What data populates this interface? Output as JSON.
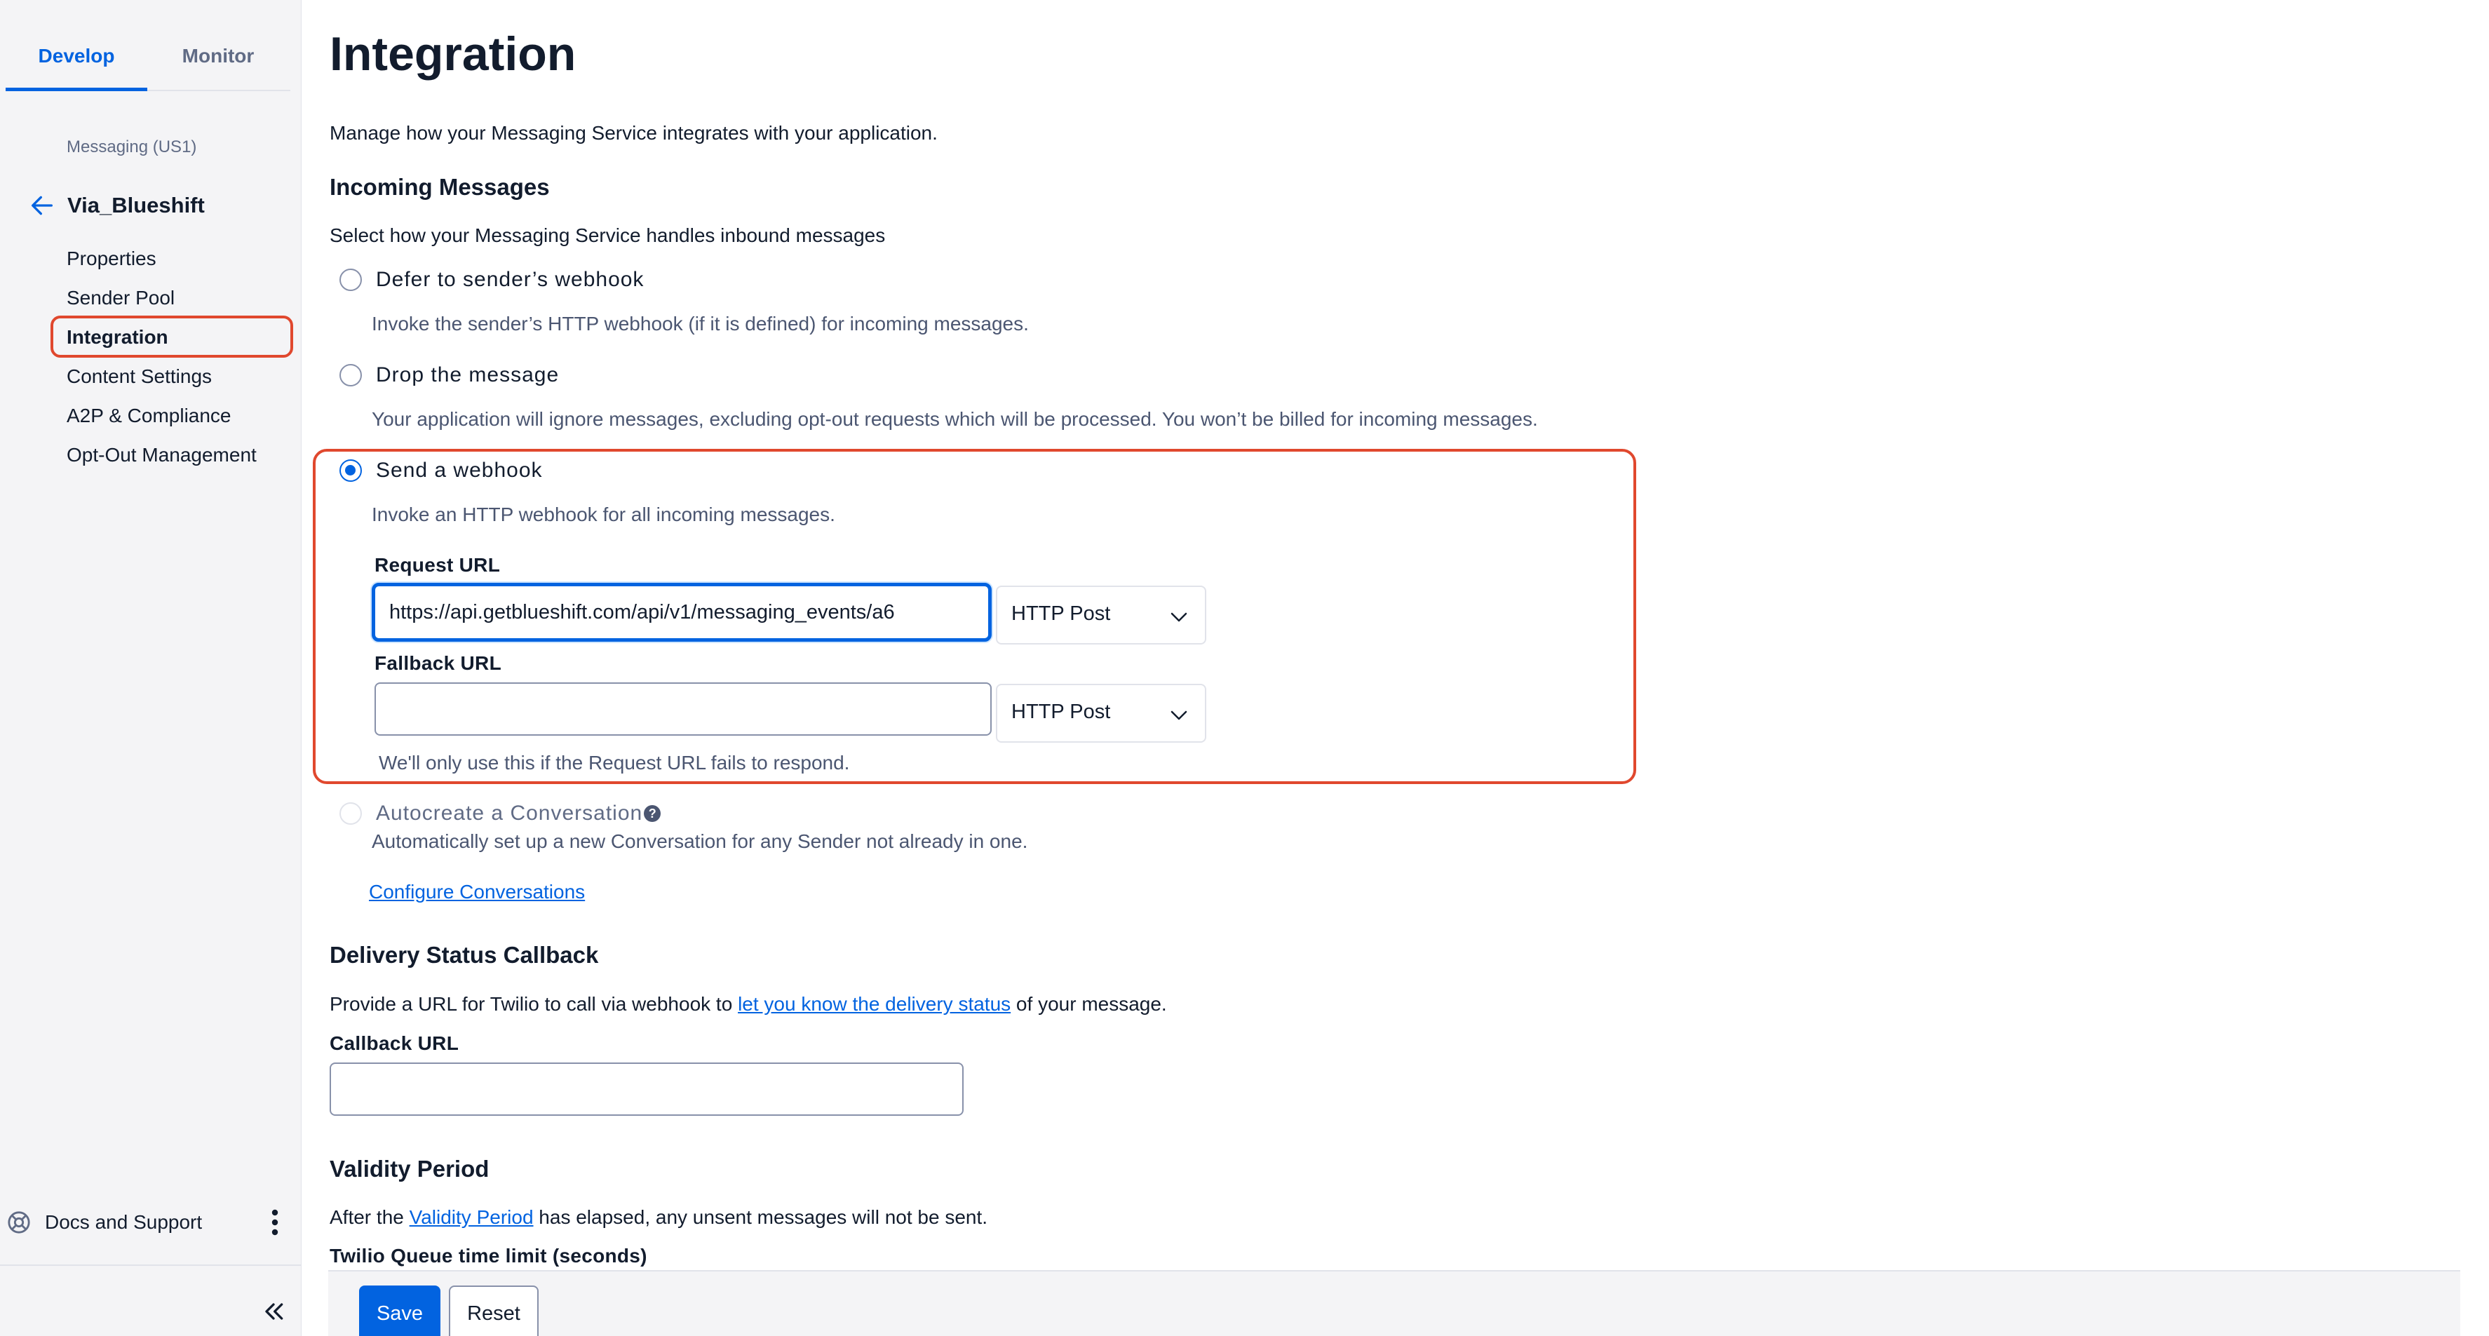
{
  "sidebar": {
    "tabs": [
      {
        "label": "Develop",
        "active": true
      },
      {
        "label": "Monitor",
        "active": false
      }
    ],
    "region_label": "Messaging (US1)",
    "service_name": "Via_Blueshift",
    "nav_items": [
      {
        "label": "Properties"
      },
      {
        "label": "Sender Pool"
      },
      {
        "label": "Integration",
        "active": true
      },
      {
        "label": "Content Settings"
      },
      {
        "label": "A2P & Compliance"
      },
      {
        "label": "Opt-Out Management"
      }
    ],
    "docs_label": "Docs and Support",
    "icons": {
      "back": "arrow-left-icon",
      "docs": "lifebuoy-icon",
      "more": "kebab-icon",
      "collapse": "double-chevron-left-icon"
    }
  },
  "main": {
    "title": "Integration",
    "description": "Manage how your Messaging Service integrates with your application.",
    "incoming": {
      "heading": "Incoming Messages",
      "description": "Select how your Messaging Service handles inbound messages",
      "options": [
        {
          "label": "Defer to sender’s webhook",
          "description": "Invoke the sender’s HTTP webhook (if it is defined) for incoming messages.",
          "checked": false
        },
        {
          "label": "Drop the message",
          "description": "Your application will ignore messages, excluding opt-out requests which will be processed. You won’t be billed for incoming messages.",
          "checked": false
        },
        {
          "label": "Send a webhook",
          "description": "Invoke an HTTP webhook for all incoming messages.",
          "checked": true
        }
      ],
      "request_url": {
        "label": "Request URL",
        "value": "https://api.getblueshift.com/api/v1/messaging_events/a6",
        "method": "HTTP Post"
      },
      "fallback_url": {
        "label": "Fallback URL",
        "value": "",
        "method": "HTTP Post",
        "hint": "We'll only use this if the Request URL fails to respond."
      },
      "autocreate": {
        "label": "Autocreate a Conversation",
        "description": "Automatically set up a new Conversation for any Sender not already in one.",
        "link": "Configure Conversations"
      }
    },
    "delivery": {
      "heading": "Delivery Status Callback",
      "text_before": "Provide a URL for Twilio to call via webhook to ",
      "link": "let you know the delivery status",
      "text_after": " of your message.",
      "callback_label": "Callback URL",
      "callback_value": ""
    },
    "validity": {
      "heading": "Validity Period",
      "text_before": "After the ",
      "link": "Validity Period",
      "text_after": " has elapsed, any unsent messages will not be sent.",
      "queue_label": "Twilio Queue time limit (seconds)"
    },
    "actions": {
      "save": "Save",
      "reset": "Reset"
    }
  },
  "colors": {
    "accent": "#0263e0",
    "highlight": "#e0482e",
    "text": "#121c2d",
    "muted": "#606b85"
  }
}
